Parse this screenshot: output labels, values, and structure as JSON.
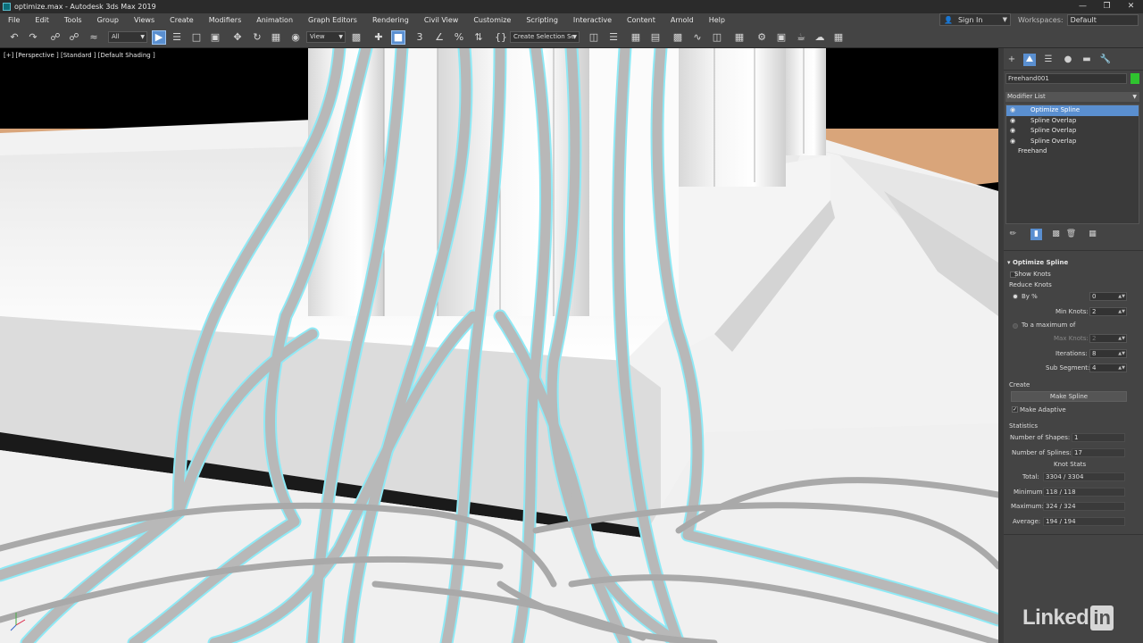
{
  "window": {
    "title": "optimize.max - Autodesk 3ds Max 2019",
    "controls": [
      "—",
      "❐",
      "✕"
    ]
  },
  "menubar": {
    "items": [
      "File",
      "Edit",
      "Tools",
      "Group",
      "Views",
      "Create",
      "Modifiers",
      "Animation",
      "Graph Editors",
      "Rendering",
      "Civil View",
      "Customize",
      "Scripting",
      "Interactive",
      "Content",
      "Arnold",
      "Help"
    ],
    "signin": "Sign In",
    "workspaces_label": "Workspaces:",
    "workspaces_value": "Default"
  },
  "toolbar": {
    "selection_filter": "All",
    "reference_coord": "View",
    "named_selection": "Create Selection Se"
  },
  "viewport": {
    "label": "[+] [Perspective ] [Standard ] [Default Shading ]",
    "axis_icon": "axis-tripod-icon"
  },
  "command_panel": {
    "object_name": "Freehand001",
    "object_color": "#2fc42f",
    "modifier_list_label": "Modifier List",
    "stack": [
      {
        "label": "Optimize Spline",
        "selected": true,
        "eye": true
      },
      {
        "label": "Spline Overlap",
        "selected": false,
        "eye": true
      },
      {
        "label": "Spline Overlap",
        "selected": false,
        "eye": true
      },
      {
        "label": "Spline Overlap",
        "selected": false,
        "eye": true
      },
      {
        "label": "Freehand",
        "selected": false,
        "eye": false
      }
    ],
    "rollout": {
      "title": "Optimize Spline",
      "show_knots": "Show Knots",
      "reduce_knots": "Reduce Knots",
      "by_percent": "By %",
      "by_percent_value": "0",
      "min_knots_label": "Min Knots:",
      "min_knots_value": "2",
      "to_max_label": "To a maximum of",
      "max_knots_label": "Max Knots:",
      "max_knots_value": "2",
      "iterations_label": "Iterations:",
      "iterations_value": "8",
      "sub_segment_label": "Sub Segment:",
      "sub_segment_value": "4",
      "create_label": "Create",
      "make_spline_button": "Make Spline",
      "make_adaptive": "Make Adaptive",
      "statistics_label": "Statistics",
      "num_shapes_label": "Number of Shapes:",
      "num_shapes_value": "1",
      "num_splines_label": "Number of Splines:",
      "num_splines_value": "17",
      "knot_stats_label": "Knot Stats",
      "total_label": "Total:",
      "total_value": "3304 / 3304",
      "minimum_label": "Minimum:",
      "minimum_value": "118 / 118",
      "maximum_label": "Maximum:",
      "maximum_value": "324 / 324",
      "average_label": "Average:",
      "average_value": "194 / 194"
    }
  },
  "watermark": {
    "text": "Linked",
    "badge": "in"
  }
}
